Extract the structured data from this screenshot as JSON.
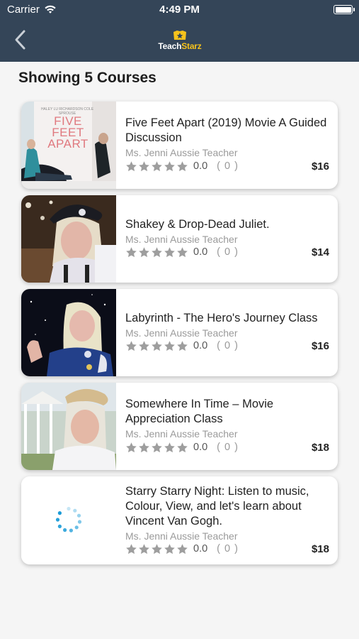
{
  "status_bar": {
    "carrier": "Carrier",
    "time": "4:49 PM"
  },
  "header": {
    "logo_part1": "Teach",
    "logo_part2": "Starz"
  },
  "page_title": "Showing 5 Courses",
  "rating_count_text": "( 0 )",
  "courses": [
    {
      "title_line1": "Five Feet Apart (2019) Movie A Guided",
      "title_line2": "Discussion",
      "teacher": "Ms. Jenni Aussie Teacher",
      "rating": "0.0",
      "price": "$16",
      "poster_title": "FIVE FEET APART",
      "poster_small": "HALEY LU RICHARDSON  COLE SPROUSE"
    },
    {
      "title_line1": "Shakey & Drop-Dead Juliet.",
      "teacher": "Ms. Jenni Aussie Teacher",
      "rating": "0.0",
      "price": "$14"
    },
    {
      "title_line1": "Labyrinth - The Hero's Journey Class",
      "teacher": "Ms. Jenni Aussie Teacher",
      "rating": "0.0",
      "price": "$16"
    },
    {
      "title_line1": "Somewhere In Time – Movie",
      "title_line2": "Appreciation Class",
      "teacher": "Ms. Jenni Aussie Teacher",
      "rating": "0.0",
      "price": "$18"
    },
    {
      "title_line1": "Starry Starry Night: Listen to music,",
      "title_line2": "Colour, View, and let's learn about",
      "title_line3": "Vincent Van Gogh.",
      "teacher": "Ms. Jenni Aussie Teacher",
      "rating": "0.0",
      "price": "$18"
    }
  ],
  "colors": {
    "header_bg": "#344558",
    "logo_accent": "#f6c21c",
    "star": "#9e9e9e",
    "spinner": "#1a9bd7"
  },
  "icons": {
    "back": "chevron-left-icon",
    "wifi": "wifi-icon",
    "battery": "battery-icon",
    "star": "star-icon",
    "logo": "teachstarz-star-icon",
    "loading": "spinner-icon"
  }
}
